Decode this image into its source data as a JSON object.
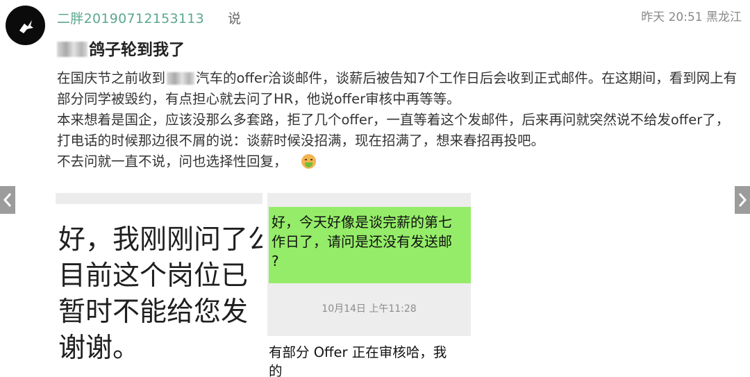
{
  "post": {
    "username": "二胖20190712153113",
    "action": "说",
    "time": "昨天 20:51",
    "location": "黑龙江",
    "title": "鸽子轮到我了",
    "paragraphs": {
      "p1a": "在国庆节之前收到",
      "p1b": "汽车的offer洽谈邮件，谈薪后被告知7个工作日后会收到正式邮件。在这期间，看到网上有部分同学被毁约，有点担心就去问了HR，他说offer审核中再等等。",
      "p2": "本来想着是国企，应该没那么多套路，拒了几个offer，一直等着这个发邮件，后来再问就突然说不给发offer了，打电话的时候那边很不屑的说：谈薪时候没招满，现在招满了，想来春招再投吧。",
      "p3": "不去问就一直不说，问也选择性回复，"
    },
    "emoji": "nauseated-face-icon"
  },
  "images": {
    "left": {
      "lines": [
        "好，我刚刚问了公",
        "目前这个岗位已",
        "暂时不能给您发",
        "谢谢。"
      ]
    },
    "right": {
      "bubble_lines": [
        "好，今天好像是谈完薪的第七",
        "作日了，请问是还没有发送邮",
        "?"
      ],
      "timestamp": "10月14日 上午11:28",
      "reply_lines": [
        "有部分 Offer 正在审核哈，我",
        "的"
      ]
    }
  },
  "nav": {
    "prev": "prev-arrow",
    "next": "next-arrow"
  },
  "colors": {
    "username": "#5aa88d",
    "bubble": "#95ec69",
    "chat_bg": "#ededed"
  }
}
